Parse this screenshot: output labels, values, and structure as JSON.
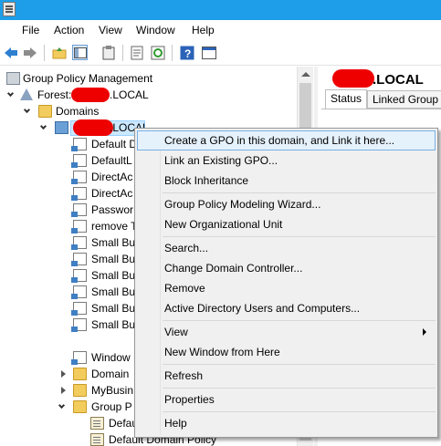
{
  "menubar": {
    "items": [
      "File",
      "Action",
      "View",
      "Window",
      "Help"
    ]
  },
  "toolbar": {
    "buttons": [
      "back-icon",
      "forward-icon",
      "up-folder-icon",
      "show-hide-tree-icon",
      "clipboard-icon",
      "properties-icon",
      "refresh-icon",
      "help-icon",
      "console-icon"
    ]
  },
  "tree": {
    "root": "Group Policy Management",
    "forest_prefix": "Forest: ",
    "forest_suffix": ".LOCAL",
    "domains": "Domains",
    "domain_suffix": ".LOCAL",
    "children": [
      "Default D",
      "DefaultL",
      "DirectAc",
      "DirectAc",
      "Passwor",
      "remove T",
      "Small Bu",
      "Small Bu",
      "Small Bu",
      "Small Bu",
      "Small Bu",
      "Small Bu",
      "Window",
      "Domain",
      "MyBusin",
      "Group P",
      "Defaul",
      "Default Domain Policy"
    ]
  },
  "right_pane": {
    "title_suffix": ".LOCAL",
    "tabs": [
      "Status",
      "Linked Group Po"
    ]
  },
  "context_menu": {
    "items": [
      "Create a GPO in this domain, and Link it here...",
      "Link an Existing GPO...",
      "Block Inheritance",
      "Group Policy Modeling Wizard...",
      "New Organizational Unit",
      "Search...",
      "Change Domain Controller...",
      "Remove",
      "Active Directory Users and Computers...",
      "View",
      "New Window from Here",
      "Refresh",
      "Properties",
      "Help"
    ]
  },
  "colors": {
    "titlebar": "#1e9ee8",
    "redaction": "#ee0000",
    "highlight": "#e5f1fb"
  }
}
